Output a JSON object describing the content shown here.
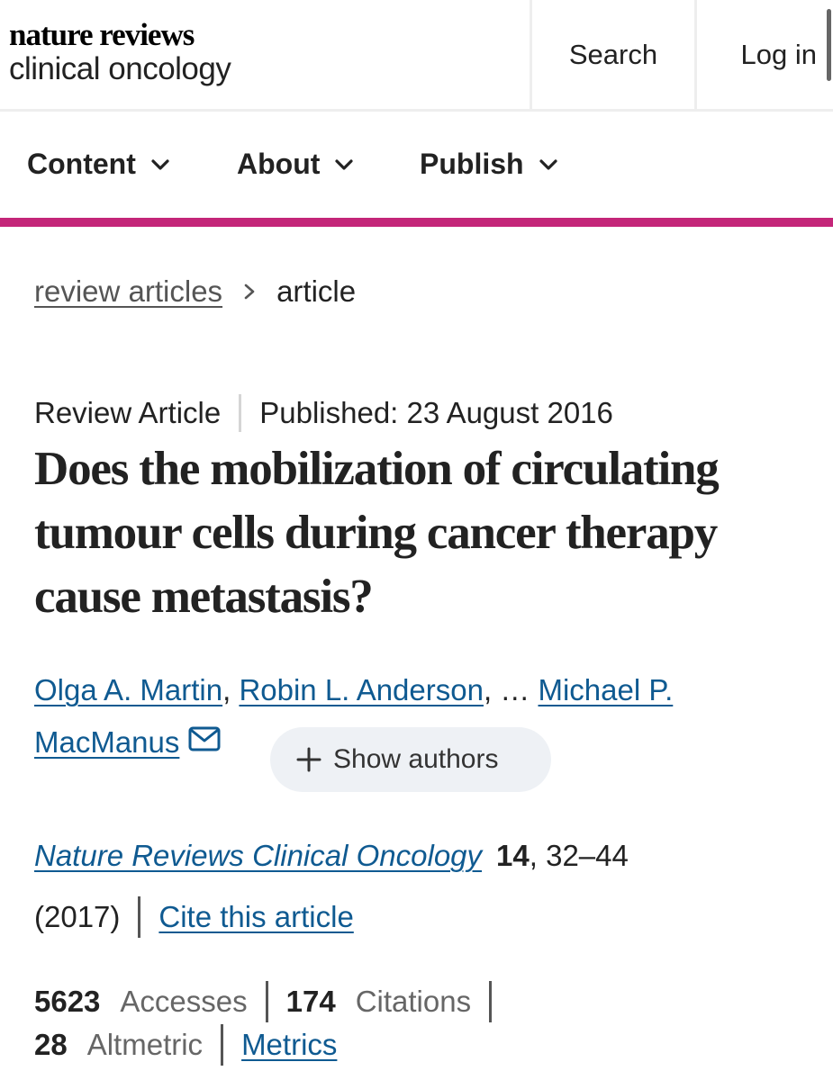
{
  "header": {
    "logo_line1": "nature reviews",
    "logo_line2": "clinical oncology",
    "search_label": "Search",
    "login_label": "Log in"
  },
  "nav": {
    "items": [
      {
        "label": "Content",
        "icon": "chevron-down-icon"
      },
      {
        "label": "About",
        "icon": "chevron-down-icon"
      },
      {
        "label": "Publish",
        "icon": "chevron-down-icon"
      }
    ]
  },
  "colors": {
    "accent": "#c42679",
    "link": "#0f5a91",
    "pill_bg": "#eef1f5"
  },
  "breadcrumb": {
    "parent": "review articles",
    "separator_icon": "chevron-right-icon",
    "current": "article"
  },
  "article": {
    "type": "Review Article",
    "published": "Published: 23 August 2016",
    "title": "Does the mobilization of circulating tumour cells during cancer therapy cause metastasis?",
    "authors": {
      "author1": "Olga A. Martin",
      "sep1": ",",
      "author2": "Robin L. Anderson",
      "ellipsis": ", … ",
      "author3_part1": "Michael P.",
      "author3_part2": "MacManus",
      "mail_icon": "mail-icon",
      "show_authors": "Show authors",
      "show_icon": "plus-icon"
    },
    "journal": {
      "name": "Nature Reviews Clinical Oncology",
      "volume": "14",
      "pages": ", 32–44",
      "year": "(2017)",
      "cite_label": "Cite this article"
    },
    "metrics": {
      "accesses_value": "5623",
      "accesses_label": "Accesses",
      "citations_value": "174",
      "citations_label": "Citations",
      "altmetric_value": "28",
      "altmetric_label": "Altmetric",
      "metrics_link": "Metrics"
    }
  }
}
